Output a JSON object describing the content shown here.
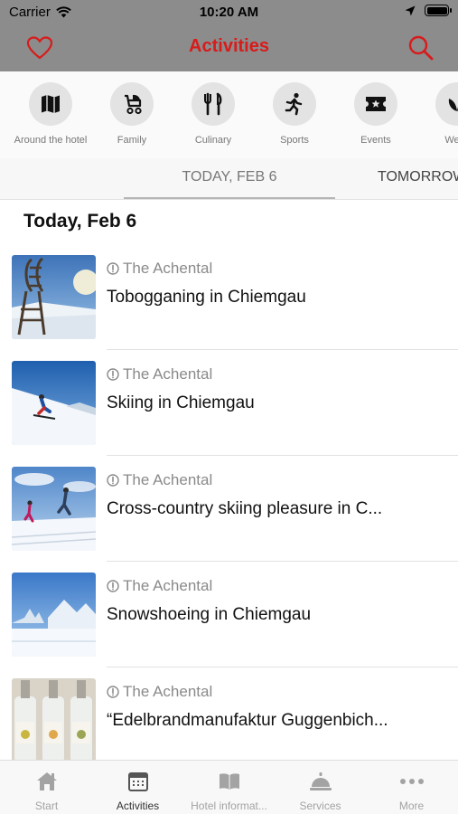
{
  "status_bar": {
    "carrier": "Carrier",
    "time": "10:20 AM"
  },
  "nav": {
    "title": "Activities",
    "title_color": "#d81b1b",
    "left_icon": "heart-icon",
    "right_icon": "search-icon"
  },
  "categories": [
    {
      "label": "Around the hotel",
      "icon": "map-icon"
    },
    {
      "label": "Family",
      "icon": "stroller-icon"
    },
    {
      "label": "Culinary",
      "icon": "cutlery-icon"
    },
    {
      "label": "Sports",
      "icon": "runner-icon"
    },
    {
      "label": "Events",
      "icon": "ticket-icon"
    },
    {
      "label": "Welln",
      "icon": "wellness-icon"
    }
  ],
  "date_tabs": {
    "active": "TODAY, FEB 6",
    "next": "TOMORROW"
  },
  "section_title": "Today, Feb 6",
  "activities": [
    {
      "venue": "The Achental",
      "title": "Tobogganing in Chiemgau"
    },
    {
      "venue": "The Achental",
      "title": "Skiing in Chiemgau"
    },
    {
      "venue": "The Achental",
      "title": "Cross-country skiing pleasure in C..."
    },
    {
      "venue": "The Achental",
      "title": "Snowshoeing in Chiemgau"
    },
    {
      "venue": "The Achental",
      "title": "“Edelbrandmanufaktur Guggenbich..."
    }
  ],
  "tab_bar": [
    {
      "label": "Start",
      "icon": "home-icon"
    },
    {
      "label": "Activities",
      "icon": "calendar-icon",
      "active": true
    },
    {
      "label": "Hotel informat...",
      "icon": "book-icon"
    },
    {
      "label": "Services",
      "icon": "service-bell-icon"
    },
    {
      "label": "More",
      "icon": "more-dots-icon"
    }
  ]
}
